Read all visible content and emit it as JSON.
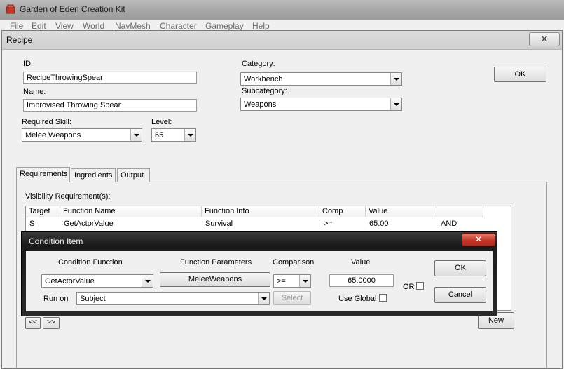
{
  "app": {
    "title": "Garden of Eden Creation Kit",
    "menu": [
      "File",
      "Edit",
      "View",
      "World",
      "NavMesh",
      "Character",
      "Gameplay",
      "Help"
    ]
  },
  "recipe": {
    "title": "Recipe",
    "close_glyph": "✕",
    "id_label": "ID:",
    "id_value": "RecipeThrowingSpear",
    "name_label": "Name:",
    "name_value": "Improvised Throwing Spear",
    "skill_label": "Required Skill:",
    "skill_value": "Melee Weapons",
    "level_label": "Level:",
    "level_value": "65",
    "category_label": "Category:",
    "category_value": "Workbench",
    "subcategory_label": "Subcategory:",
    "subcategory_value": "Weapons",
    "ok_label": "OK",
    "tabs": [
      "Requirements",
      "Ingredients",
      "Output"
    ],
    "visibility_label": "Visibility Requirement(s):",
    "table": {
      "columns": [
        "Target",
        "Function Name",
        "Function Info",
        "Comp",
        "Value",
        ""
      ],
      "rows": [
        [
          "S",
          "GetActorValue",
          "Survival",
          ">=",
          "65.00",
          "AND"
        ]
      ]
    },
    "prev_label": "<<",
    "next_label": ">>",
    "new_label": "New"
  },
  "condition": {
    "title": "Condition Item",
    "close_glyph": "✕",
    "function_header": "Condition Function",
    "function_value": "GetActorValue",
    "params_header": "Function Parameters",
    "params_button": "MeleeWeapons",
    "comparison_header": "Comparison",
    "comparison_value": ">=",
    "value_header": "Value",
    "value_value": "65.0000",
    "or_label": "OR",
    "run_on_label": "Run on",
    "run_on_value": "Subject",
    "select_label": "Select",
    "use_global_label": "Use Global",
    "ok_label": "OK",
    "cancel_label": "Cancel"
  }
}
